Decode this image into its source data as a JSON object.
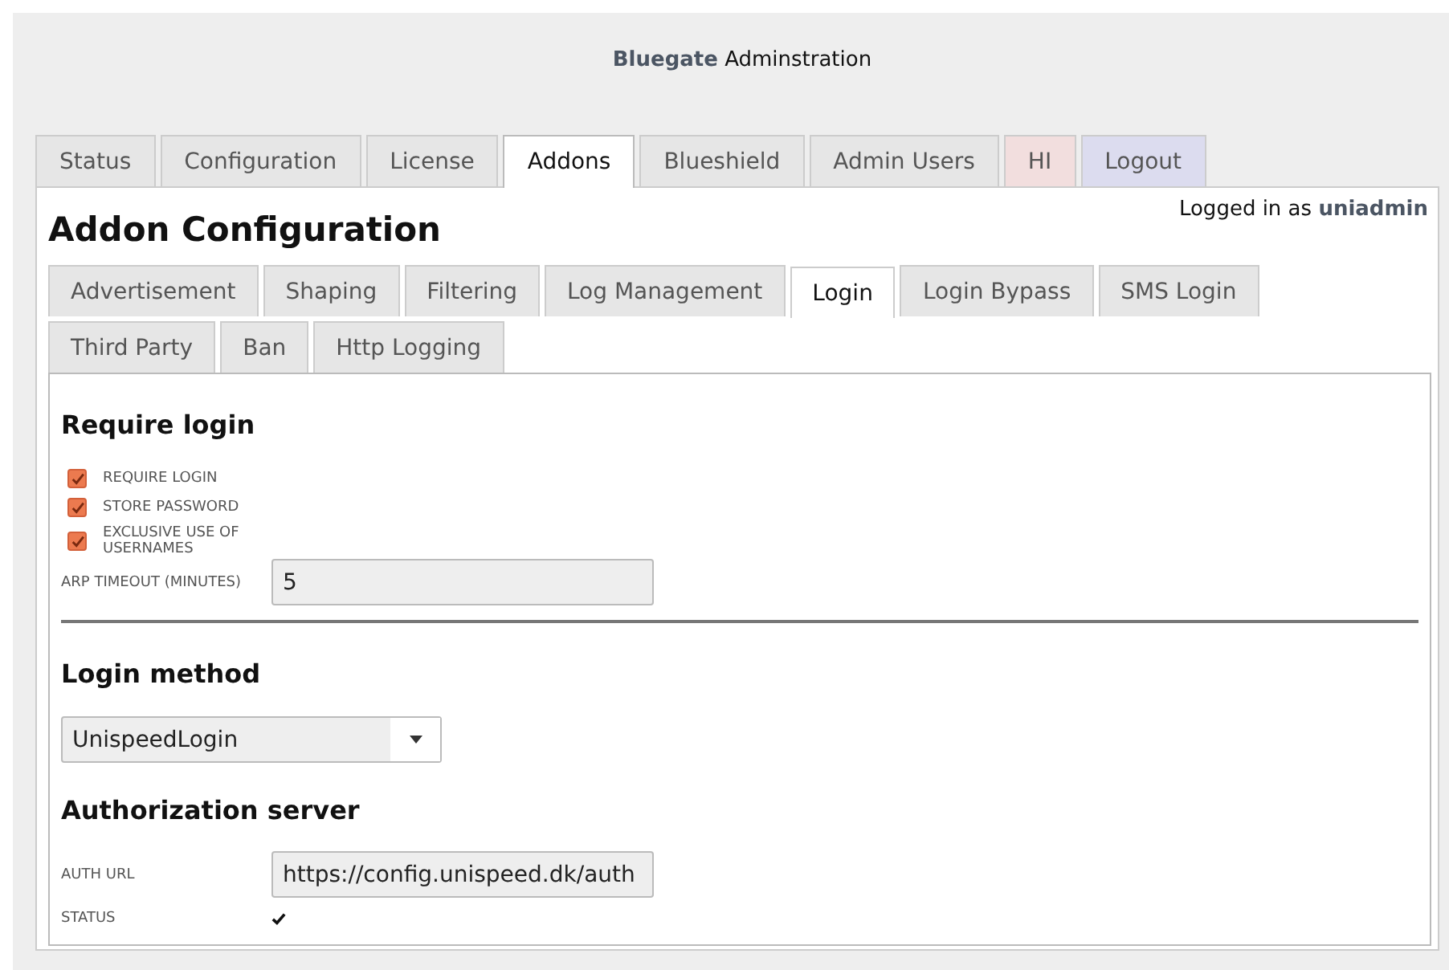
{
  "header": {
    "brand": "Bluegate",
    "title": "Adminstration"
  },
  "main_tabs": [
    {
      "label": "Status",
      "selected": false,
      "color": "#e6e6e6"
    },
    {
      "label": "Configuration",
      "selected": false,
      "color": "#e6e6e6"
    },
    {
      "label": "License",
      "selected": false,
      "color": "#e6e6e6"
    },
    {
      "label": "Addons",
      "selected": true,
      "color": "#ffffff"
    },
    {
      "label": "Blueshield",
      "selected": false,
      "color": "#e6e6e6"
    },
    {
      "label": "Admin Users",
      "selected": false,
      "color": "#e6e6e6"
    },
    {
      "label": "HI",
      "selected": false,
      "color": "#f2dede"
    },
    {
      "label": "Logout",
      "selected": false,
      "color": "#dcdcef"
    }
  ],
  "login_status": {
    "prefix": "Logged in as",
    "user": "uniadmin"
  },
  "page_title": "Addon Configuration",
  "sub_tabs": [
    {
      "label": "Advertisement",
      "selected": false
    },
    {
      "label": "Shaping",
      "selected": false
    },
    {
      "label": "Filtering",
      "selected": false
    },
    {
      "label": "Log Management",
      "selected": false
    },
    {
      "label": "Login",
      "selected": true
    },
    {
      "label": "Login Bypass",
      "selected": false
    },
    {
      "label": "SMS Login",
      "selected": false
    },
    {
      "label": "Third Party",
      "selected": false
    },
    {
      "label": "Ban",
      "selected": false
    },
    {
      "label": "Http Logging",
      "selected": false
    }
  ],
  "require_login": {
    "heading": "Require login",
    "checkboxes": [
      {
        "label": "REQUIRE LOGIN",
        "checked": true
      },
      {
        "label": "STORE PASSWORD",
        "checked": true
      },
      {
        "label": "EXCLUSIVE USE OF USERNAMES",
        "checked": true
      }
    ],
    "arp_timeout": {
      "label": "ARP TIMEOUT (MINUTES)",
      "value": "5"
    }
  },
  "login_method": {
    "heading": "Login method",
    "value": "UnispeedLogin"
  },
  "authorization_server": {
    "heading": "Authorization server",
    "auth_url": {
      "label": "AUTH URL",
      "value": "https://config.unispeed.dk/auth"
    },
    "status": {
      "label": "STATUS",
      "ok": true
    }
  }
}
